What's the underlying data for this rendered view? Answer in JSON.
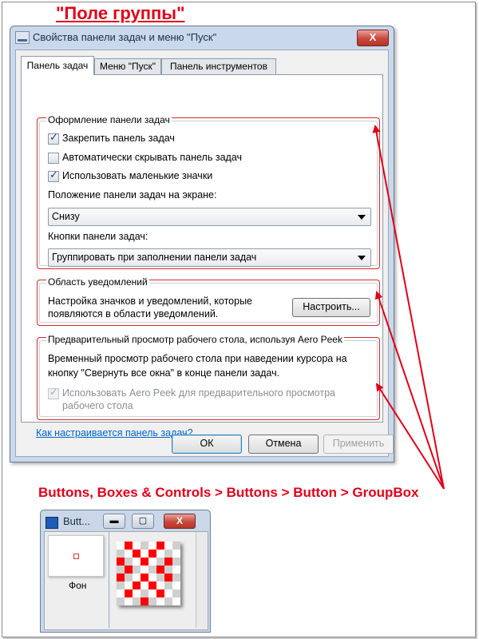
{
  "heading": "\"Поле группы\"",
  "dialog": {
    "title": "Свойства панели задач и меню \"Пуск\"",
    "close_glyph": "X",
    "tabs": [
      {
        "label": "Панель задач",
        "active": true
      },
      {
        "label": "Меню \"Пуск\"",
        "active": false
      },
      {
        "label": "Панель инструментов",
        "active": false
      }
    ],
    "group_taskbar": {
      "title": "Оформление панели задач",
      "checkboxes": [
        {
          "label": "Закрепить панель задач",
          "checked": true
        },
        {
          "label": "Автоматически скрывать панель задач",
          "checked": false
        },
        {
          "label": "Использовать маленькие значки",
          "checked": true
        }
      ],
      "position_label": "Положение панели задач на экране:",
      "position_value": "Снизу",
      "buttons_label": "Кнопки панели задач:",
      "buttons_value": "Группировать при заполнении панели задач"
    },
    "group_notify": {
      "title": "Область уведомлений",
      "text_line1": "Настройка значков и уведомлений, которые",
      "text_line2": "появляются в области уведомлений.",
      "configure_button": "Настроить..."
    },
    "group_peek": {
      "title": "Предварительный просмотр рабочего стола, используя Aero Peek",
      "text_line1": "Временный просмотр рабочего стола при наведении курсора на",
      "text_line2": "кнопку \"Свернуть все окна\" в конце панели задач.",
      "checkbox_line1": "Использовать Aero Peek для предварительного просмотра",
      "checkbox_line2": "рабочего стола",
      "checkbox_checked": true,
      "checkbox_disabled": true
    },
    "help_link": "Как настраивается панель задач?",
    "ok_button": "ОК",
    "cancel_button": "Отмена",
    "apply_button": "Применить"
  },
  "caption": "Buttons, Boxes & Controls > Buttons > Button > GroupBox",
  "mini_window": {
    "title": "Butt...",
    "minimize_glyph": "▬",
    "maximize_glyph": "▢",
    "close_glyph": "X",
    "thumbnail_label": "Фон"
  },
  "colors": {
    "annotation_red": "#e0001a",
    "dialog_frame": "#c9d8ea",
    "link_blue": "#0066cc",
    "pattern_red": "#ff0000"
  }
}
